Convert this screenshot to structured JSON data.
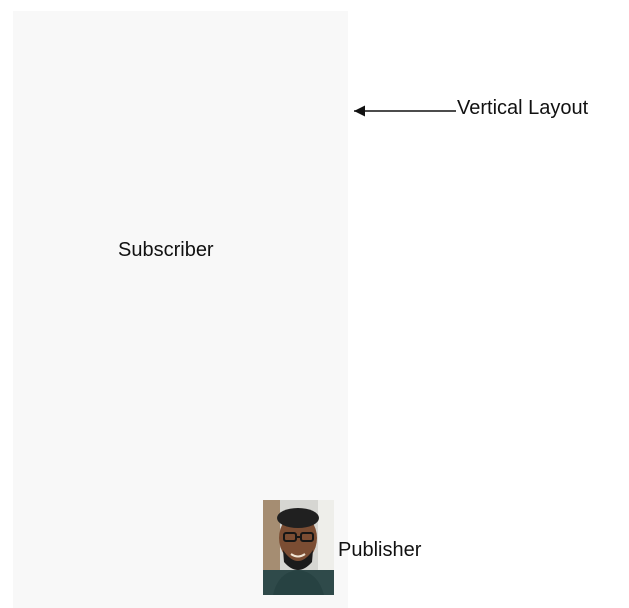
{
  "diagram": {
    "container_label": "Subscriber",
    "callout_label": "Vertical Layout",
    "publisher_label": "Publisher",
    "publisher_image": "person-avatar",
    "colors": {
      "container_background": "#f8f8f8",
      "text": "#111111",
      "arrow": "#111111"
    }
  }
}
